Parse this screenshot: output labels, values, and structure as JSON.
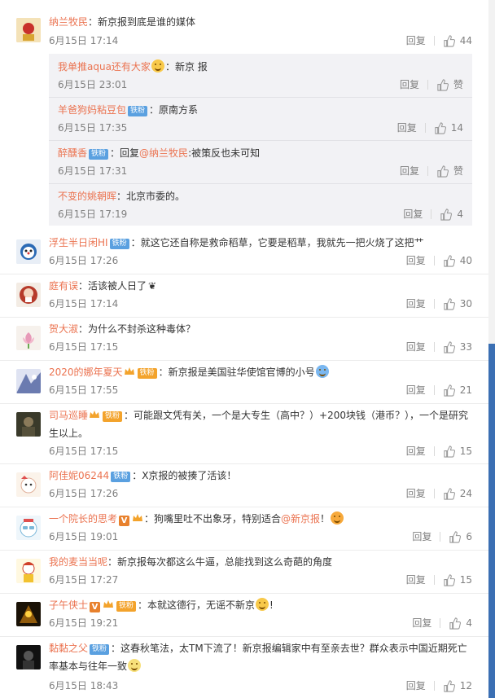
{
  "comments": [
    {
      "name": "纳兰牧民",
      "text": "：新京报到底是谁的媒体",
      "time": "6月15日 17:14",
      "reply": "回复",
      "likes": "44",
      "avatar_color": "#c8302b"
    },
    {
      "name": "浮生半日闲HI",
      "badge": "铁粉",
      "text": "：就这它还自称是救命稻草，它要是稻草，我就先一把火烧了这把艹",
      "time": "6月15日 17:26",
      "reply": "回复",
      "likes": "40",
      "avatar_color": "#2b6ab5"
    },
    {
      "name": "庭有误",
      "text": "：活该被人日了",
      "time": "6月15日 17:14",
      "reply": "回复",
      "likes": "30",
      "avatar_color": "#b63a2a"
    },
    {
      "name": "贺大淑",
      "text": "：为什么不封杀这种毒体？",
      "time": "6月15日 17:15",
      "reply": "回复",
      "likes": "33",
      "avatar_color": "#e79ab8"
    },
    {
      "name": "2020的娜年夏天",
      "badge": "铁粉",
      "text": "：新京报是美国驻华使馆官博的小号",
      "time": "6月15日 17:55",
      "reply": "回复",
      "likes": "21",
      "avatar_color": "#6b7bb0"
    },
    {
      "name": "司马巡睡",
      "badge": "铁粉",
      "text": "：可能跟文凭有关，一个是大专生（高中？）+200块钱（港币？），一个是研究生以上。",
      "time": "6月15日 17:15",
      "reply": "回复",
      "likes": "15",
      "avatar_color": "#3a3a2a"
    },
    {
      "name": "阿佳妮06244",
      "badge": "铁粉",
      "text": "：X京报的被揍了活该！",
      "time": "6月15日 17:26",
      "reply": "回复",
      "likes": "24",
      "avatar_color": "#e0b09a"
    },
    {
      "name": "一个院长的思考",
      "text": "：狗嘴里吐不出象牙，特别适合",
      "mention": "@新京报",
      "tail": "！",
      "time": "6月15日 19:01",
      "reply": "回复",
      "likes": "6",
      "avatar_color": "#7ab7d9"
    },
    {
      "name": "我的麦当当呢",
      "text": "：新京报每次都这么牛逼，总能找到这么奇葩的角度",
      "time": "6月15日 17:27",
      "reply": "回复",
      "likes": "15",
      "avatar_color": "#d0402a"
    },
    {
      "name": "子午侠士",
      "badge": "铁粉",
      "text": "：本就这德行，无谣不新京",
      "time": "6月15日 19:21",
      "reply": "回复",
      "likes": "4",
      "avatar_color": "#8a5a10"
    },
    {
      "name": "黏黏之父",
      "badge": "铁粉",
      "text": "：这春秋笔法，太TM下流了！新京报编辑家中有至亲去世？群众表示中国近期死亡率基本与往年一致",
      "time": "6月15日 18:43",
      "reply": "回复",
      "likes": "12",
      "avatar_color": "#222222"
    }
  ],
  "subcomments": [
    {
      "name": "我单推aqua还有大家",
      "text": "：新京  报",
      "time": "6月15日 23:01",
      "reply": "回复",
      "likes": "赞"
    },
    {
      "name": "羊爸狗妈粘豆包",
      "badge": "铁粉",
      "text": "：原南方系",
      "time": "6月15日 17:35",
      "reply": "回复",
      "likes": "14"
    },
    {
      "name": "醉醺香",
      "badge": "铁粉",
      "text": "：回复",
      "mention": "@纳兰牧民",
      "tail": ":被策反也未可知",
      "time": "6月15日 17:31",
      "reply": "回复",
      "likes": "赞"
    },
    {
      "name": "不变的姚朝晖",
      "text": "：北京市委的。",
      "time": "6月15日 17:19",
      "reply": "回复",
      "likes": "4"
    }
  ]
}
